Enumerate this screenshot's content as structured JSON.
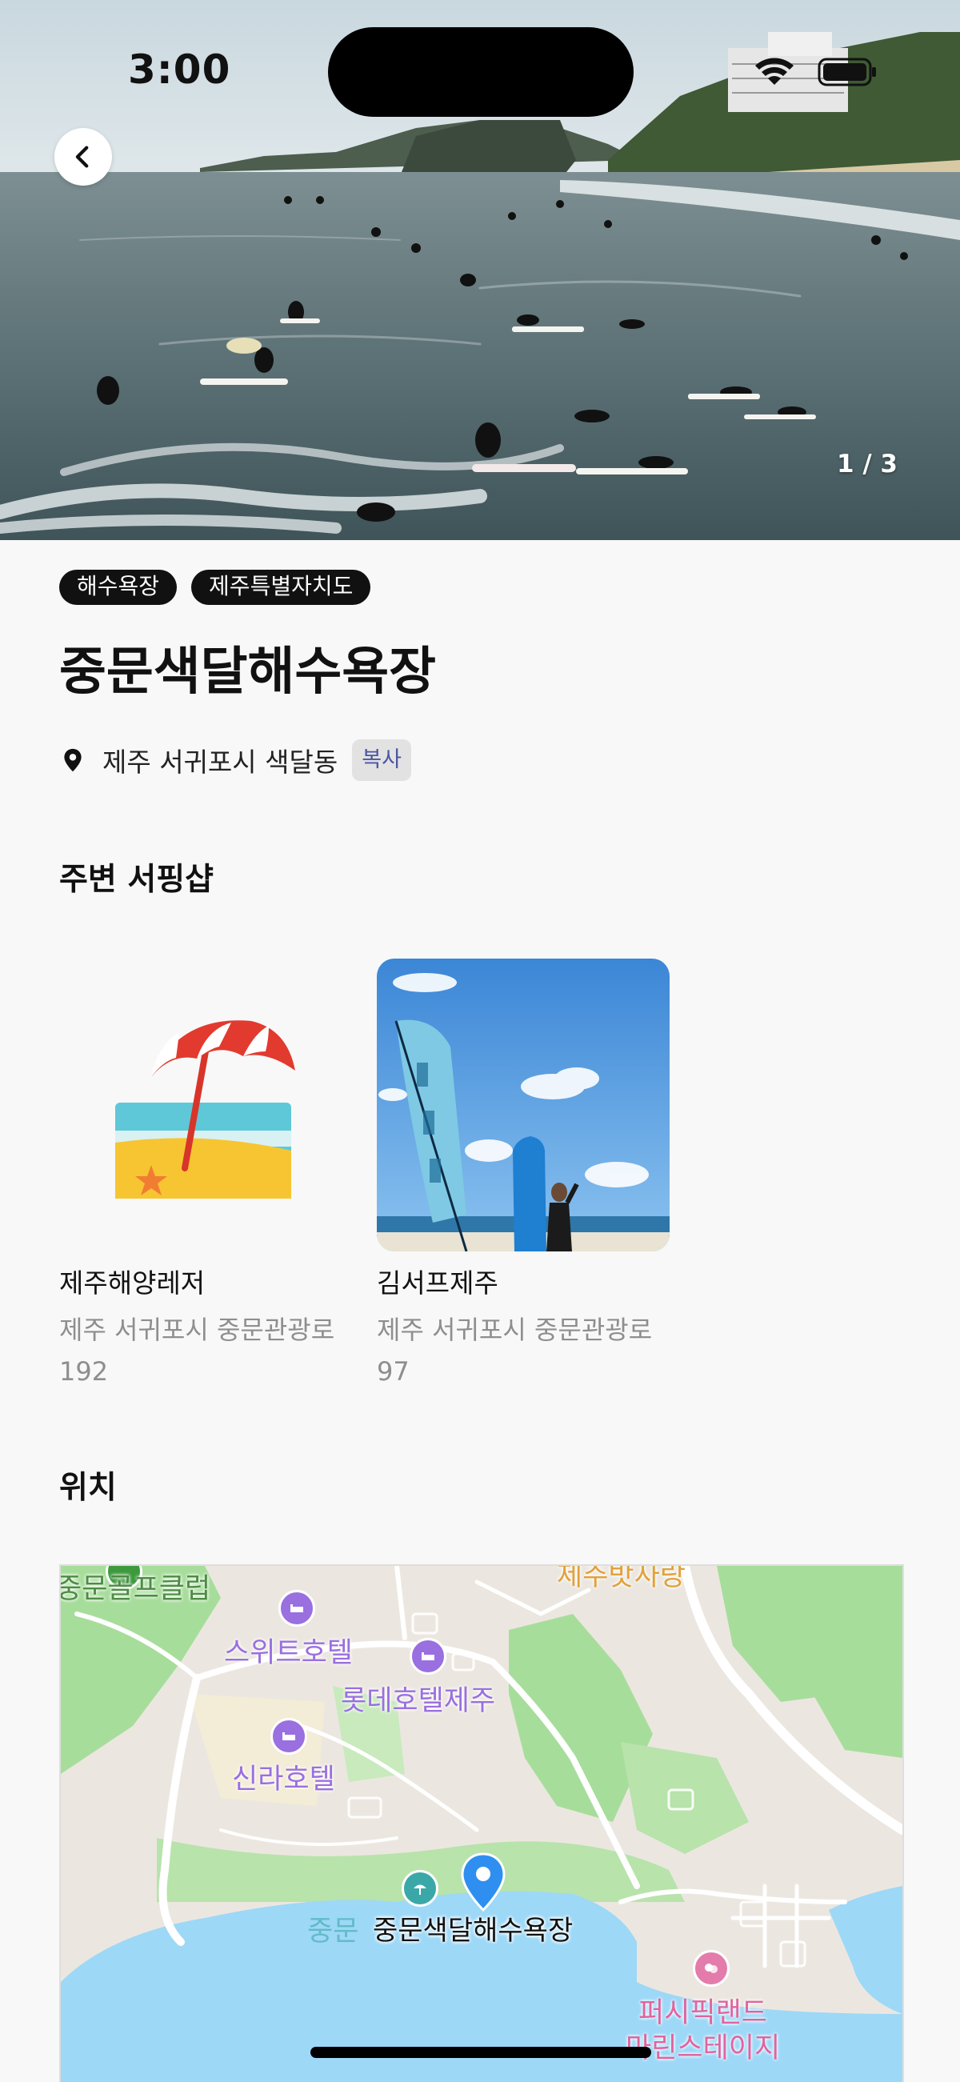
{
  "status_bar": {
    "time": "3:00"
  },
  "hero": {
    "pager": "1 / 3"
  },
  "tags": [
    "해수욕장",
    "제주특별자치도"
  ],
  "place": {
    "title": "중문색달해수욕장",
    "address": "제주 서귀포시 색달동",
    "copy_label": "복사"
  },
  "sections": {
    "shops_title": "주변 서핑샵",
    "location_title": "위치"
  },
  "shops": [
    {
      "name": "제주해양레저",
      "address": "제주 서귀포시 중문관광로 192",
      "thumbnail": "beach-umbrella-emoji"
    },
    {
      "name": "김서프제주",
      "address": "제주 서귀포시 중문관광로 97",
      "thumbnail": "surfshop-photo"
    }
  ],
  "map": {
    "labels": {
      "golf": "중문골프클럽",
      "restaurant": "제주밧사랑",
      "sweet_hotel": "스위트호텔",
      "lotte_hotel": "롯데호텔제주",
      "shilla_hotel": "신라호텔",
      "beach_faded": "중문",
      "marker": "중문색달해수욕장",
      "pacific_line1": "퍼시픽랜드",
      "pacific_line2": "마린스테이지"
    },
    "colors": {
      "hotel": "#9a6fe0",
      "water": "#9dd8f7",
      "marker": "#2f8ff0"
    }
  }
}
